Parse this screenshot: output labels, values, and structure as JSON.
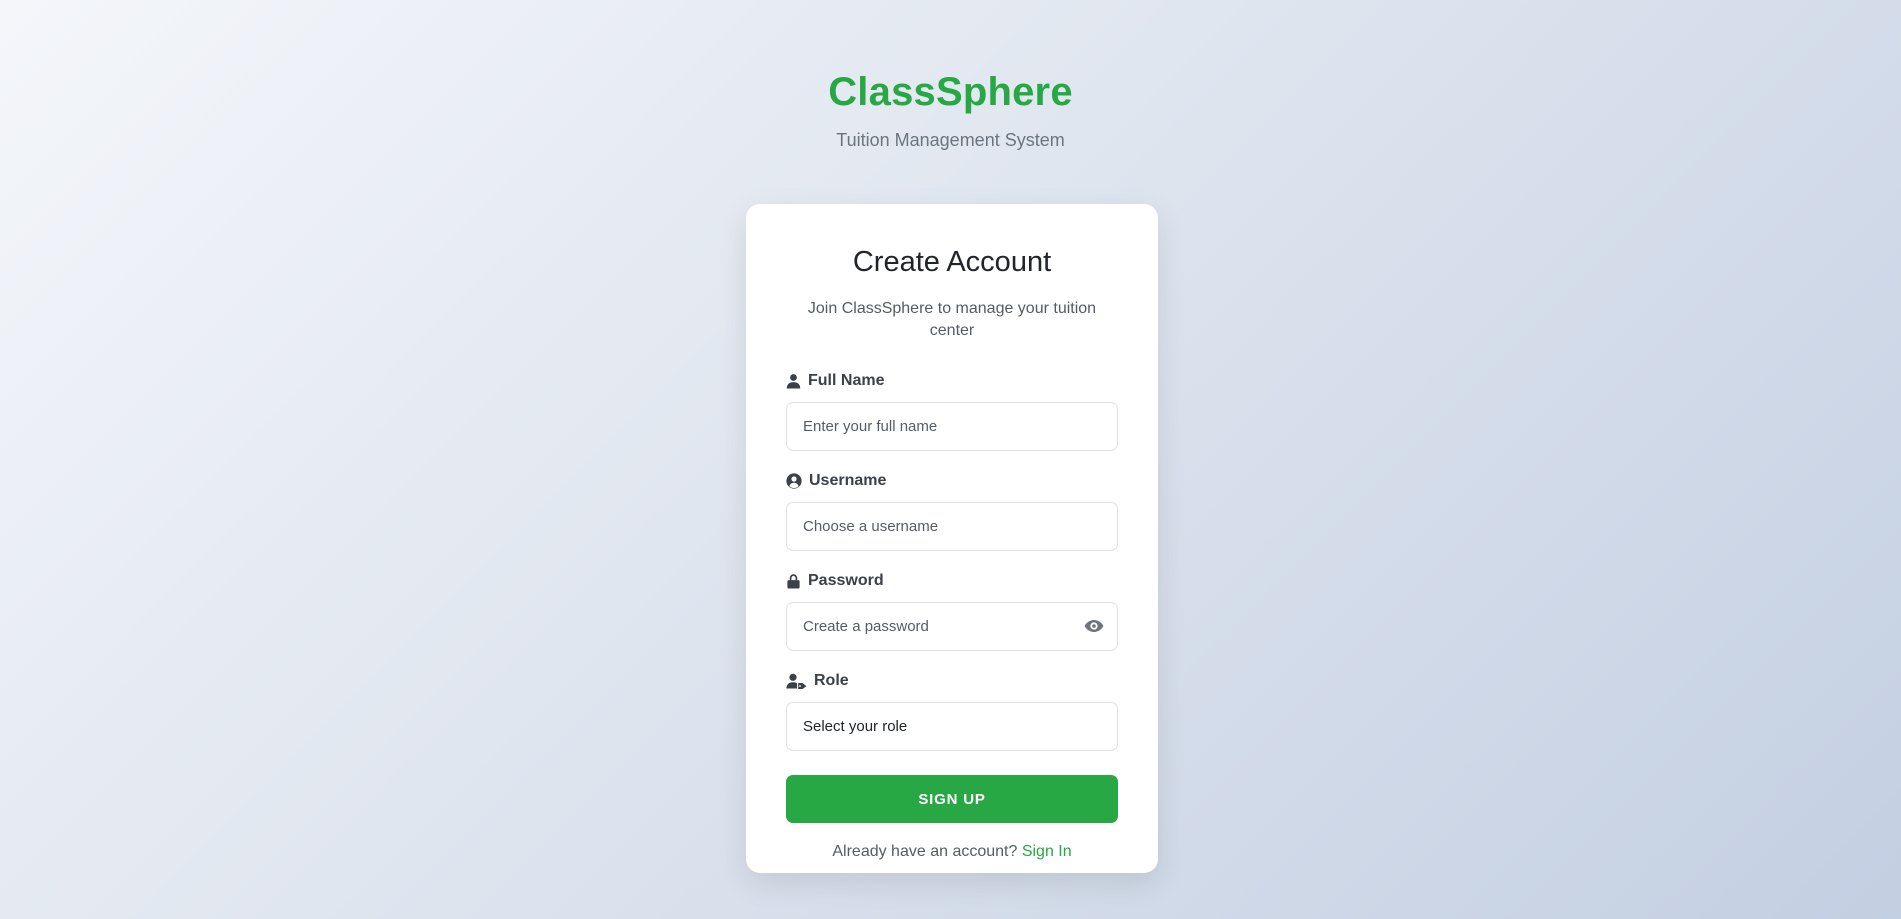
{
  "brand": {
    "title": "ClassSphere",
    "subtitle": "Tuition Management System"
  },
  "card": {
    "title": "Create Account",
    "subtitle": "Join ClassSphere to manage your tuition center"
  },
  "fields": {
    "full_name": {
      "label": "Full Name",
      "icon": "user-icon",
      "placeholder": "Enter your full name"
    },
    "username": {
      "label": "Username",
      "icon": "user-circle-icon",
      "placeholder": "Choose a username"
    },
    "password": {
      "label": "Password",
      "icon": "lock-icon",
      "placeholder": "Create a password",
      "toggle_icon": "eye-icon"
    },
    "role": {
      "label": "Role",
      "icon": "user-tag-icon",
      "selected": "Select your role"
    }
  },
  "actions": {
    "signup_label": "SIGN UP"
  },
  "footer": {
    "prompt": "Already have an account?",
    "link": "Sign In"
  },
  "colors": {
    "accent": "#28a745",
    "muted_text": "#6c757d",
    "border": "#dee2e6"
  }
}
